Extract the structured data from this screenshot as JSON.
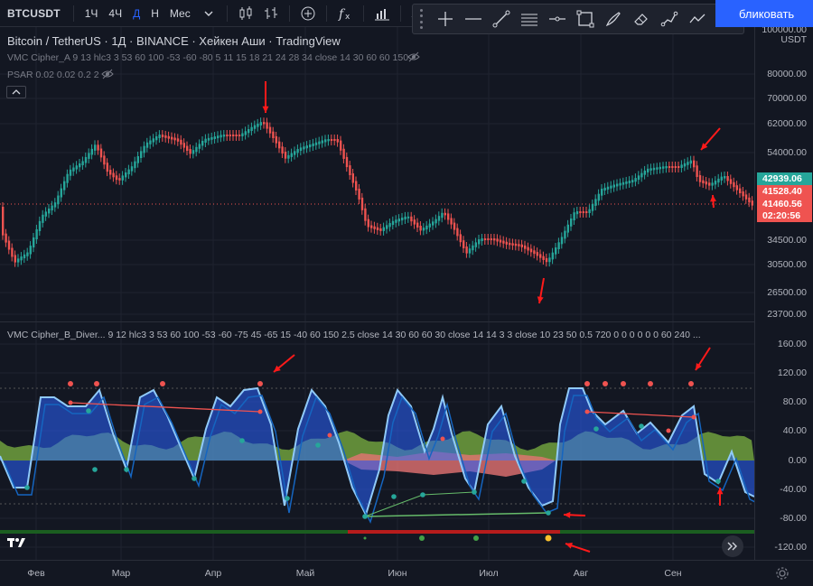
{
  "toolbar": {
    "symbol": "BTCUSDT",
    "timeframes": [
      "1Ч",
      "4Ч",
      "Д",
      "Н",
      "Мес"
    ],
    "active_timeframe": "Д",
    "publish_label": "бликовать"
  },
  "legend": {
    "title": "Bitcoin / TetherUS · 1Д · BINANCE · Хейкен Аши · TradingView",
    "indicator_a": "VMC Cipher_A 9 13 hlc3 3 53 60 100 -53 -60 -80 5 11 15 18 21 24 28 34 close 14 30 60 60 150",
    "indicator_psar": "PSAR 0.02 0.02 0.2 2",
    "indicator_b": "VMC Cipher_B_Diver...  9 12 hlc3 3 53 60 100 -53 -60 -75 45 -65 15 -40 60 150 2.5 close 14 30 60 60 30 close 14 14 3 3 close 10 23 50 0.5 720 0 0 0 0 0 0 60 240 ..."
  },
  "price_axis": {
    "currency_top": "100000.00",
    "currency": "USDT",
    "labels": [
      "80000.00",
      "70000.00",
      "62000.00",
      "54000.00",
      "34500.00",
      "30500.00",
      "26500.00",
      "23700.00"
    ],
    "tags": [
      {
        "text": "42939.06",
        "color": "#26a69a"
      },
      {
        "text": "41528.40",
        "color": "#ef5350"
      },
      {
        "text": "41460.56",
        "color": "#ef5350"
      },
      {
        "text": "02:20:56",
        "color": "#ef5350"
      }
    ],
    "osc_labels": [
      "160.00",
      "120.00",
      "80.00",
      "40.00",
      "0.00",
      "-40.00",
      "-80.00",
      "-120.00"
    ]
  },
  "time_axis": {
    "labels": [
      "Фев",
      "Мар",
      "Апр",
      "Май",
      "Июн",
      "Июл",
      "Авг",
      "Сен"
    ]
  },
  "colors": {
    "background": "#131722",
    "up": "#26a69a",
    "down": "#ef5350",
    "accent": "#2962ff",
    "arrow": "#ff1a1a"
  },
  "icons": {
    "drawing_tools": [
      "crosshair-icon",
      "horizontal-ray-icon",
      "trend-line-icon",
      "parallel-channel-icon",
      "horizontal-line-icon",
      "rectangle-icon",
      "brush-icon",
      "eraser-icon",
      "path-icon",
      "polyline-icon",
      "text-cursor-icon"
    ]
  }
}
